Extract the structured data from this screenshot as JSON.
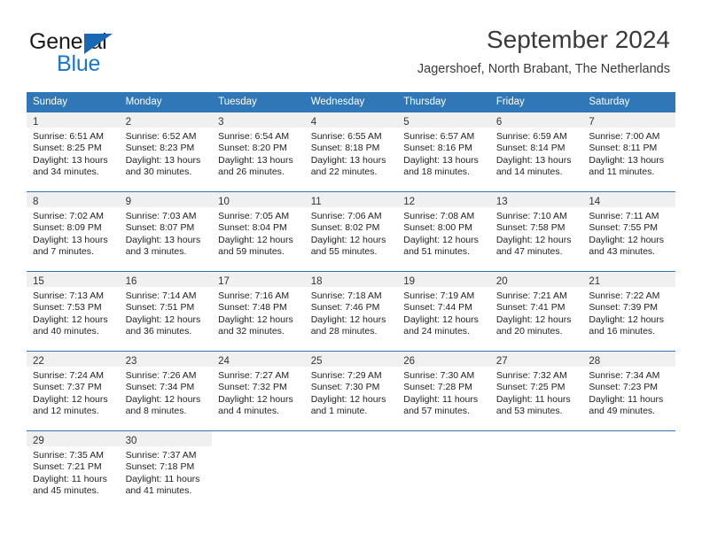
{
  "brand": {
    "name_part1": "General",
    "name_part2": "Blue",
    "accent_color": "#1868b4"
  },
  "header": {
    "month_title": "September 2024",
    "location": "Jagershoef, North Brabant, The Netherlands"
  },
  "calendar": {
    "header_color": "#3077b8",
    "weekday_headers": [
      "Sunday",
      "Monday",
      "Tuesday",
      "Wednesday",
      "Thursday",
      "Friday",
      "Saturday"
    ],
    "weeks": [
      [
        {
          "day": "1",
          "sunrise": "Sunrise: 6:51 AM",
          "sunset": "Sunset: 8:25 PM",
          "daylight_line1": "Daylight: 13 hours",
          "daylight_line2": "and 34 minutes."
        },
        {
          "day": "2",
          "sunrise": "Sunrise: 6:52 AM",
          "sunset": "Sunset: 8:23 PM",
          "daylight_line1": "Daylight: 13 hours",
          "daylight_line2": "and 30 minutes."
        },
        {
          "day": "3",
          "sunrise": "Sunrise: 6:54 AM",
          "sunset": "Sunset: 8:20 PM",
          "daylight_line1": "Daylight: 13 hours",
          "daylight_line2": "and 26 minutes."
        },
        {
          "day": "4",
          "sunrise": "Sunrise: 6:55 AM",
          "sunset": "Sunset: 8:18 PM",
          "daylight_line1": "Daylight: 13 hours",
          "daylight_line2": "and 22 minutes."
        },
        {
          "day": "5",
          "sunrise": "Sunrise: 6:57 AM",
          "sunset": "Sunset: 8:16 PM",
          "daylight_line1": "Daylight: 13 hours",
          "daylight_line2": "and 18 minutes."
        },
        {
          "day": "6",
          "sunrise": "Sunrise: 6:59 AM",
          "sunset": "Sunset: 8:14 PM",
          "daylight_line1": "Daylight: 13 hours",
          "daylight_line2": "and 14 minutes."
        },
        {
          "day": "7",
          "sunrise": "Sunrise: 7:00 AM",
          "sunset": "Sunset: 8:11 PM",
          "daylight_line1": "Daylight: 13 hours",
          "daylight_line2": "and 11 minutes."
        }
      ],
      [
        {
          "day": "8",
          "sunrise": "Sunrise: 7:02 AM",
          "sunset": "Sunset: 8:09 PM",
          "daylight_line1": "Daylight: 13 hours",
          "daylight_line2": "and 7 minutes."
        },
        {
          "day": "9",
          "sunrise": "Sunrise: 7:03 AM",
          "sunset": "Sunset: 8:07 PM",
          "daylight_line1": "Daylight: 13 hours",
          "daylight_line2": "and 3 minutes."
        },
        {
          "day": "10",
          "sunrise": "Sunrise: 7:05 AM",
          "sunset": "Sunset: 8:04 PM",
          "daylight_line1": "Daylight: 12 hours",
          "daylight_line2": "and 59 minutes."
        },
        {
          "day": "11",
          "sunrise": "Sunrise: 7:06 AM",
          "sunset": "Sunset: 8:02 PM",
          "daylight_line1": "Daylight: 12 hours",
          "daylight_line2": "and 55 minutes."
        },
        {
          "day": "12",
          "sunrise": "Sunrise: 7:08 AM",
          "sunset": "Sunset: 8:00 PM",
          "daylight_line1": "Daylight: 12 hours",
          "daylight_line2": "and 51 minutes."
        },
        {
          "day": "13",
          "sunrise": "Sunrise: 7:10 AM",
          "sunset": "Sunset: 7:58 PM",
          "daylight_line1": "Daylight: 12 hours",
          "daylight_line2": "and 47 minutes."
        },
        {
          "day": "14",
          "sunrise": "Sunrise: 7:11 AM",
          "sunset": "Sunset: 7:55 PM",
          "daylight_line1": "Daylight: 12 hours",
          "daylight_line2": "and 43 minutes."
        }
      ],
      [
        {
          "day": "15",
          "sunrise": "Sunrise: 7:13 AM",
          "sunset": "Sunset: 7:53 PM",
          "daylight_line1": "Daylight: 12 hours",
          "daylight_line2": "and 40 minutes."
        },
        {
          "day": "16",
          "sunrise": "Sunrise: 7:14 AM",
          "sunset": "Sunset: 7:51 PM",
          "daylight_line1": "Daylight: 12 hours",
          "daylight_line2": "and 36 minutes."
        },
        {
          "day": "17",
          "sunrise": "Sunrise: 7:16 AM",
          "sunset": "Sunset: 7:48 PM",
          "daylight_line1": "Daylight: 12 hours",
          "daylight_line2": "and 32 minutes."
        },
        {
          "day": "18",
          "sunrise": "Sunrise: 7:18 AM",
          "sunset": "Sunset: 7:46 PM",
          "daylight_line1": "Daylight: 12 hours",
          "daylight_line2": "and 28 minutes."
        },
        {
          "day": "19",
          "sunrise": "Sunrise: 7:19 AM",
          "sunset": "Sunset: 7:44 PM",
          "daylight_line1": "Daylight: 12 hours",
          "daylight_line2": "and 24 minutes."
        },
        {
          "day": "20",
          "sunrise": "Sunrise: 7:21 AM",
          "sunset": "Sunset: 7:41 PM",
          "daylight_line1": "Daylight: 12 hours",
          "daylight_line2": "and 20 minutes."
        },
        {
          "day": "21",
          "sunrise": "Sunrise: 7:22 AM",
          "sunset": "Sunset: 7:39 PM",
          "daylight_line1": "Daylight: 12 hours",
          "daylight_line2": "and 16 minutes."
        }
      ],
      [
        {
          "day": "22",
          "sunrise": "Sunrise: 7:24 AM",
          "sunset": "Sunset: 7:37 PM",
          "daylight_line1": "Daylight: 12 hours",
          "daylight_line2": "and 12 minutes."
        },
        {
          "day": "23",
          "sunrise": "Sunrise: 7:26 AM",
          "sunset": "Sunset: 7:34 PM",
          "daylight_line1": "Daylight: 12 hours",
          "daylight_line2": "and 8 minutes."
        },
        {
          "day": "24",
          "sunrise": "Sunrise: 7:27 AM",
          "sunset": "Sunset: 7:32 PM",
          "daylight_line1": "Daylight: 12 hours",
          "daylight_line2": "and 4 minutes."
        },
        {
          "day": "25",
          "sunrise": "Sunrise: 7:29 AM",
          "sunset": "Sunset: 7:30 PM",
          "daylight_line1": "Daylight: 12 hours",
          "daylight_line2": "and 1 minute."
        },
        {
          "day": "26",
          "sunrise": "Sunrise: 7:30 AM",
          "sunset": "Sunset: 7:28 PM",
          "daylight_line1": "Daylight: 11 hours",
          "daylight_line2": "and 57 minutes."
        },
        {
          "day": "27",
          "sunrise": "Sunrise: 7:32 AM",
          "sunset": "Sunset: 7:25 PM",
          "daylight_line1": "Daylight: 11 hours",
          "daylight_line2": "and 53 minutes."
        },
        {
          "day": "28",
          "sunrise": "Sunrise: 7:34 AM",
          "sunset": "Sunset: 7:23 PM",
          "daylight_line1": "Daylight: 11 hours",
          "daylight_line2": "and 49 minutes."
        }
      ],
      [
        {
          "day": "29",
          "sunrise": "Sunrise: 7:35 AM",
          "sunset": "Sunset: 7:21 PM",
          "daylight_line1": "Daylight: 11 hours",
          "daylight_line2": "and 45 minutes."
        },
        {
          "day": "30",
          "sunrise": "Sunrise: 7:37 AM",
          "sunset": "Sunset: 7:18 PM",
          "daylight_line1": "Daylight: 11 hours",
          "daylight_line2": "and 41 minutes."
        },
        {
          "day": "",
          "sunrise": "",
          "sunset": "",
          "daylight_line1": "",
          "daylight_line2": ""
        },
        {
          "day": "",
          "sunrise": "",
          "sunset": "",
          "daylight_line1": "",
          "daylight_line2": ""
        },
        {
          "day": "",
          "sunrise": "",
          "sunset": "",
          "daylight_line1": "",
          "daylight_line2": ""
        },
        {
          "day": "",
          "sunrise": "",
          "sunset": "",
          "daylight_line1": "",
          "daylight_line2": ""
        },
        {
          "day": "",
          "sunrise": "",
          "sunset": "",
          "daylight_line1": "",
          "daylight_line2": ""
        }
      ]
    ]
  }
}
